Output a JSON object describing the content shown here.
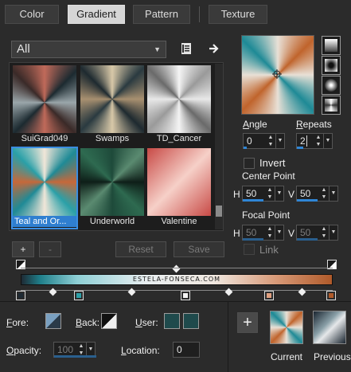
{
  "tabs": [
    {
      "label": "Color",
      "active": false
    },
    {
      "label": "Gradient",
      "active": true
    },
    {
      "label": "Pattern",
      "active": false
    },
    {
      "label": "Texture",
      "active": false
    }
  ],
  "category": {
    "selected": "All"
  },
  "swatches": [
    {
      "label": "SuiGrad049",
      "selected": false
    },
    {
      "label": "Swamps",
      "selected": false
    },
    {
      "label": "TD_Cancer",
      "selected": false
    },
    {
      "label": "Teal and Or...",
      "selected": true
    },
    {
      "label": "Underworld",
      "selected": false
    },
    {
      "label": "Valentine",
      "selected": false
    }
  ],
  "buttons": {
    "add": "+",
    "remove": "-",
    "reset": "Reset",
    "save": "Save",
    "add_custom": "+"
  },
  "controls": {
    "angle_label": "Angle",
    "angle_value": "0",
    "repeats_label": "Repeats",
    "repeats_value": "2",
    "invert_label": "Invert",
    "center_point_label": "Center Point",
    "center_h_label": "H",
    "center_h_value": "50",
    "center_v_label": "V",
    "center_v_value": "50",
    "focal_point_label": "Focal Point",
    "focal_h_label": "H",
    "focal_h_value": "50",
    "focal_v_label": "V",
    "focal_v_value": "50",
    "link_label": "Link"
  },
  "editor": {
    "watermark": "ESTELA-FONSECA.COM",
    "stop_colors": [
      "#1e2a34",
      "#2ea0a8",
      "#f4f4f4",
      "#e0a080",
      "#b05a2a"
    ]
  },
  "bottom": {
    "fore_label": "Fore:",
    "back_label": "Back:",
    "user_label": "User:",
    "opacity_label": "Opacity:",
    "opacity_value": "100",
    "location_label": "Location:",
    "location_value": "0",
    "current_label": "Current",
    "previous_label": "Previous"
  },
  "colors": {
    "accent": "#2f86d6",
    "user_color_1": "#1f4a4c",
    "user_color_2": "#1f4a4c"
  }
}
